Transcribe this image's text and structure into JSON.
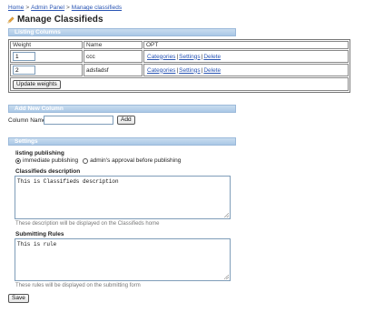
{
  "breadcrumb": {
    "items": [
      "Home",
      "Admin Panel",
      "Manage classifieds"
    ],
    "separator": ">"
  },
  "page_title": "Manage Classifieds",
  "sections": {
    "listing_columns": "Listing Columns",
    "add_new_column": "Add New Column",
    "settings": "Settings"
  },
  "table": {
    "headers": [
      "Weight",
      "Name",
      "OPT"
    ],
    "rows": [
      {
        "weight": "1",
        "name": "ccc",
        "opt": [
          "Categories",
          "Settings",
          "Delete"
        ]
      },
      {
        "weight": "2",
        "name": "adsfadsf",
        "opt": [
          "Categories",
          "Settings",
          "Delete"
        ]
      }
    ],
    "opt_separator": "|",
    "update_button": "Update weights"
  },
  "add_column": {
    "label": "Column Name:",
    "value": "",
    "button": "Add"
  },
  "settings": {
    "publishing_label": "listing publishing",
    "options": [
      {
        "label": "immediate publishing",
        "selected": true
      },
      {
        "label": "admin's approval before publishing",
        "selected": false
      }
    ],
    "description_label": "Classifieds description",
    "description_value": "This is Classifieds description",
    "description_hint": "These description will be displayed on the Classifieds home",
    "rules_label": "Submitting Rules",
    "rules_value": "This is rule",
    "rules_hint": "These rules will be displayed on the submitting form",
    "save_button": "Save"
  },
  "colors": {
    "section_bar": "#aac7e6",
    "link": "#2a55b4",
    "pencil": "#e8a43a"
  },
  "icons": {
    "title_icon": "pencil-icon"
  }
}
